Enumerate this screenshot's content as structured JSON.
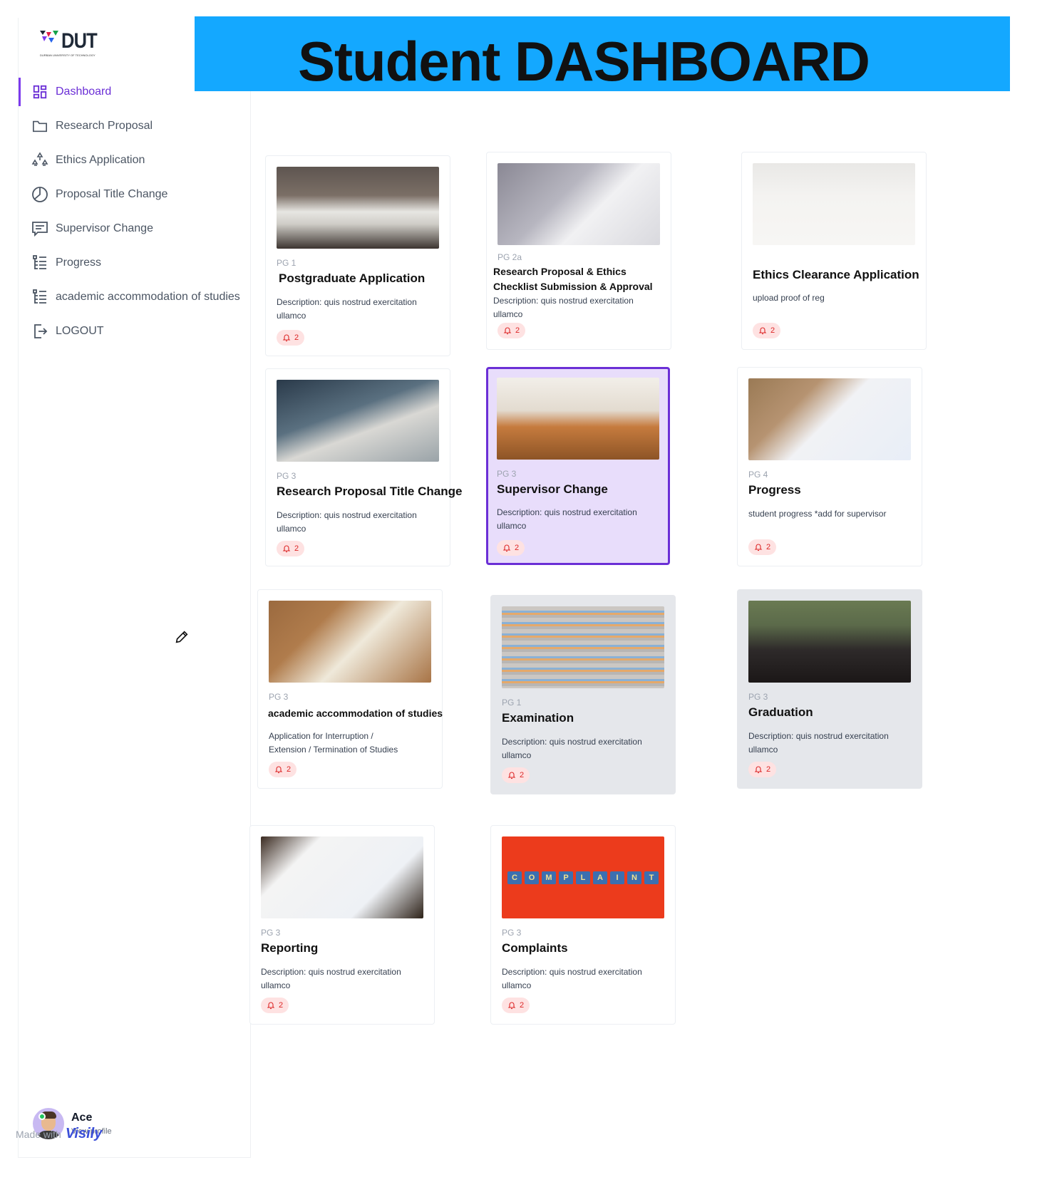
{
  "header": {
    "title": "Student DASHBOARD"
  },
  "logo": {
    "text": "DUT",
    "subtitle": "DURBAN UNIVERSITY OF TECHNOLOGY"
  },
  "sidebar": {
    "items": [
      {
        "label": "Dashboard",
        "icon": "dashboard-icon",
        "active": true
      },
      {
        "label": "Research Proposal",
        "icon": "folder-icon"
      },
      {
        "label": "Ethics Application",
        "icon": "hierarchy-icon"
      },
      {
        "label": "Proposal Title Change",
        "icon": "pie-chart-icon"
      },
      {
        "label": "Supervisor Change",
        "icon": "message-icon"
      },
      {
        "label": "Progress",
        "icon": "list-tree-icon"
      },
      {
        "label": "academic accommodation of studies",
        "icon": "list-tree-icon"
      },
      {
        "label": "LOGOUT",
        "icon": "logout-icon"
      }
    ]
  },
  "profile": {
    "name": "Ace",
    "link": "View profile"
  },
  "footer": {
    "made_with": "Made with",
    "brand": "Visily"
  },
  "cards": [
    {
      "pg": "PG 1",
      "title": "Postgraduate Application",
      "desc": "Description:  quis nostrud exercitation ullamco",
      "badge": "2"
    },
    {
      "pg": "PG 2a",
      "title": "Research Proposal & Ethics Checklist Submission & Approval",
      "desc": "Description:  quis nostrud exercitation ullamco",
      "badge": "2"
    },
    {
      "pg": "",
      "title": "Ethics Clearance Application",
      "desc": "upload proof of reg",
      "badge": "2"
    },
    {
      "pg": "PG 3",
      "title": "Research Proposal Title Change",
      "desc": "Description:  quis nostrud exercitation ullamco",
      "badge": "2"
    },
    {
      "pg": "PG 3",
      "title": "Supervisor Change",
      "desc": "Description:  quis nostrud exercitation ullamco",
      "badge": "2"
    },
    {
      "pg": "PG 4",
      "title": "Progress",
      "desc": "student progress *add for supervisor",
      "badge": "2"
    },
    {
      "pg": "PG 3",
      "title": "academic accommodation of studies",
      "desc": "Application for Interruption / Extension / Termination of Studies",
      "badge": "2"
    },
    {
      "pg": "PG 1",
      "title": "Examination",
      "desc": "Description:  quis nostrud exercitation ullamco",
      "badge": "2"
    },
    {
      "pg": "PG 3",
      "title": "Graduation",
      "desc": "Description:  quis nostrud exercitation ullamco",
      "badge": "2"
    },
    {
      "pg": "PG 3",
      "title": "Reporting",
      "desc": "Description:  quis nostrud exercitation ullamco",
      "badge": "2"
    },
    {
      "pg": "PG 3",
      "title": "Complaints",
      "desc": "Description:  quis nostrud exercitation ullamco",
      "badge": "2"
    }
  ],
  "complaint_tiles": [
    "C",
    "O",
    "M",
    "P",
    "L",
    "A",
    "I",
    "N",
    "T"
  ],
  "colors": {
    "header_bg": "#14a8ff",
    "accent": "#6b2fd6",
    "selected_bg": "#e8ddfb",
    "badge_bg": "#fee2e2",
    "badge_fg": "#dc2626"
  }
}
